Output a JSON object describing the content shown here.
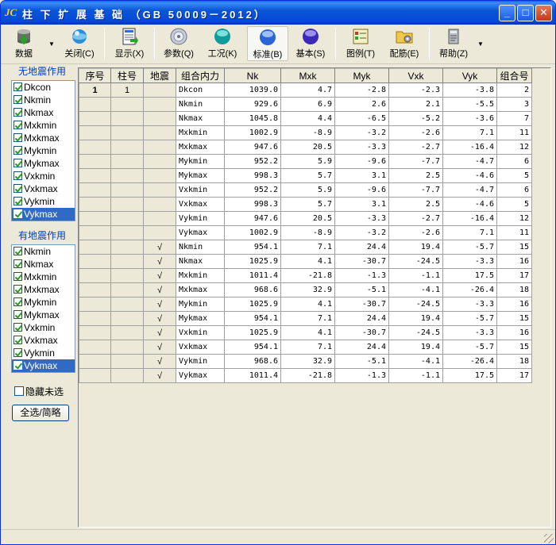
{
  "window": {
    "logo": "JC",
    "title": "柱 下 扩 展 基 础 （GB 50009－2012）",
    "minimize": "_",
    "maximize": "□",
    "close": "✕"
  },
  "toolbar": {
    "buttons": [
      {
        "id": "data",
        "label": "数据",
        "icon": "database-icon"
      },
      {
        "id": "close",
        "label": "关闭(C)",
        "icon": "globe-icon"
      },
      {
        "id": "display",
        "label": "显示(X)",
        "icon": "document-icon"
      },
      {
        "id": "params",
        "label": "参数(Q)",
        "icon": "disc-icon"
      },
      {
        "id": "workcase",
        "label": "工况(K)",
        "icon": "teal-ball-icon"
      },
      {
        "id": "standard",
        "label": "标准(B)",
        "icon": "blue-ball-icon"
      },
      {
        "id": "basic",
        "label": "基本(S)",
        "icon": "purple-ball-icon"
      },
      {
        "id": "legend",
        "label": "图例(T)",
        "icon": "legend-icon"
      },
      {
        "id": "rebar",
        "label": "配筋(E)",
        "icon": "folder-gear-icon"
      },
      {
        "id": "help",
        "label": "帮助(Z)",
        "icon": "help-icon"
      }
    ]
  },
  "non_seismic": {
    "label": "无地震作用",
    "items": [
      "Dkcon",
      "Nkmin",
      "Nkmax",
      "Mxkmin",
      "Mxkmax",
      "Mykmin",
      "Mykmax",
      "Vxkmin",
      "Vxkmax",
      "Vykmin",
      "Vykmax"
    ],
    "selected_index": 10
  },
  "seismic": {
    "label": "有地震作用",
    "items": [
      "Nkmin",
      "Nkmax",
      "Mxkmin",
      "Mxkmax",
      "Mykmin",
      "Mykmax",
      "Vxkmin",
      "Vxkmax",
      "Vykmin",
      "Vykmax"
    ],
    "selected_index": 9
  },
  "hide_unselected": {
    "label": "隐藏未选",
    "checked": false
  },
  "select_all_button": "全选/简略",
  "table": {
    "headers": [
      "序号",
      "柱号",
      "地震",
      "组合内力",
      "Nk",
      "Mxk",
      "Myk",
      "Vxk",
      "Vyk",
      "组合号"
    ],
    "rows": [
      [
        "1",
        "1",
        "",
        "Dkcon",
        "1039.0",
        "4.7",
        "-2.8",
        "-2.3",
        "-3.8",
        "2"
      ],
      [
        "",
        "",
        "",
        "Nkmin",
        "929.6",
        "6.9",
        "2.6",
        "2.1",
        "-5.5",
        "3"
      ],
      [
        "",
        "",
        "",
        "Nkmax",
        "1045.8",
        "4.4",
        "-6.5",
        "-5.2",
        "-3.6",
        "7"
      ],
      [
        "",
        "",
        "",
        "Mxkmin",
        "1002.9",
        "-8.9",
        "-3.2",
        "-2.6",
        "7.1",
        "11"
      ],
      [
        "",
        "",
        "",
        "Mxkmax",
        "947.6",
        "20.5",
        "-3.3",
        "-2.7",
        "-16.4",
        "12"
      ],
      [
        "",
        "",
        "",
        "Mykmin",
        "952.2",
        "5.9",
        "-9.6",
        "-7.7",
        "-4.7",
        "6"
      ],
      [
        "",
        "",
        "",
        "Mykmax",
        "998.3",
        "5.7",
        "3.1",
        "2.5",
        "-4.6",
        "5"
      ],
      [
        "",
        "",
        "",
        "Vxkmin",
        "952.2",
        "5.9",
        "-9.6",
        "-7.7",
        "-4.7",
        "6"
      ],
      [
        "",
        "",
        "",
        "Vxkmax",
        "998.3",
        "5.7",
        "3.1",
        "2.5",
        "-4.6",
        "5"
      ],
      [
        "",
        "",
        "",
        "Vykmin",
        "947.6",
        "20.5",
        "-3.3",
        "-2.7",
        "-16.4",
        "12"
      ],
      [
        "",
        "",
        "",
        "Vykmax",
        "1002.9",
        "-8.9",
        "-3.2",
        "-2.6",
        "7.1",
        "11"
      ],
      [
        "",
        "",
        "√",
        "Nkmin",
        "954.1",
        "7.1",
        "24.4",
        "19.4",
        "-5.7",
        "15"
      ],
      [
        "",
        "",
        "√",
        "Nkmax",
        "1025.9",
        "4.1",
        "-30.7",
        "-24.5",
        "-3.3",
        "16"
      ],
      [
        "",
        "",
        "√",
        "Mxkmin",
        "1011.4",
        "-21.8",
        "-1.3",
        "-1.1",
        "17.5",
        "17"
      ],
      [
        "",
        "",
        "√",
        "Mxkmax",
        "968.6",
        "32.9",
        "-5.1",
        "-4.1",
        "-26.4",
        "18"
      ],
      [
        "",
        "",
        "√",
        "Mykmin",
        "1025.9",
        "4.1",
        "-30.7",
        "-24.5",
        "-3.3",
        "16"
      ],
      [
        "",
        "",
        "√",
        "Mykmax",
        "954.1",
        "7.1",
        "24.4",
        "19.4",
        "-5.7",
        "15"
      ],
      [
        "",
        "",
        "√",
        "Vxkmin",
        "1025.9",
        "4.1",
        "-30.7",
        "-24.5",
        "-3.3",
        "16"
      ],
      [
        "",
        "",
        "√",
        "Vxkmax",
        "954.1",
        "7.1",
        "24.4",
        "19.4",
        "-5.7",
        "15"
      ],
      [
        "",
        "",
        "√",
        "Vykmin",
        "968.6",
        "32.9",
        "-5.1",
        "-4.1",
        "-26.4",
        "18"
      ],
      [
        "",
        "",
        "√",
        "Vykmax",
        "1011.4",
        "-21.8",
        "-1.3",
        "-1.1",
        "17.5",
        "17"
      ]
    ]
  }
}
